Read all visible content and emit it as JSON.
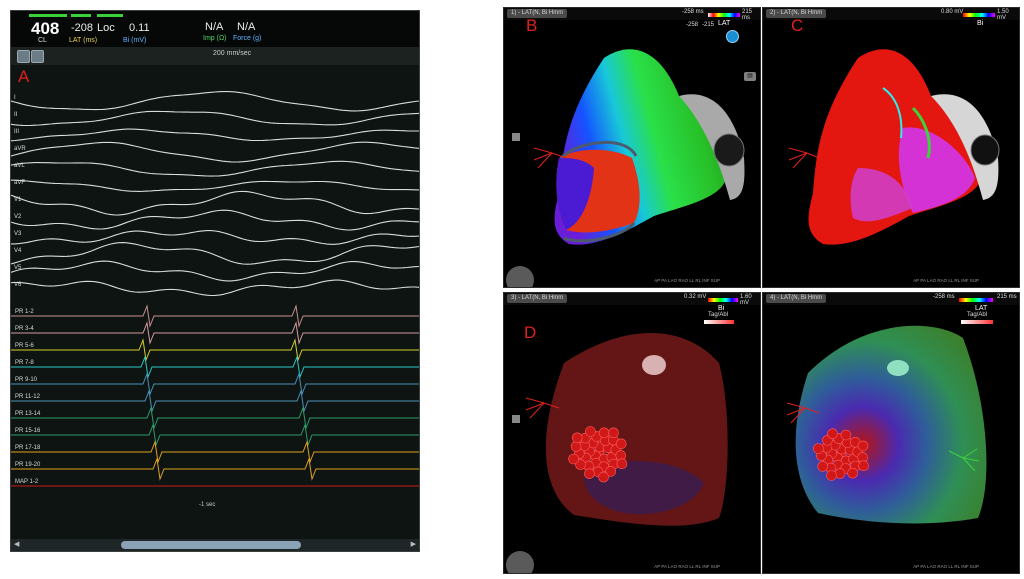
{
  "panel_a": {
    "letter": "A",
    "cl_value": "408",
    "cl_label": "CL",
    "lat_value": "-208",
    "lat_label": "LAT (ms)",
    "loc_label": "Loc",
    "bi_value": "0.11",
    "bi_label": "Bi (mV)",
    "imp_value": "N/A",
    "imp_label": "Imp (Ω)",
    "force_value": "N/A",
    "force_label": "Force (g)",
    "sweep_speed": "200 mm/sec",
    "time_scale": "-1 sec",
    "leads": [
      "I",
      "II",
      "III",
      "aVR",
      "aVL",
      "aVF",
      "V1",
      "V2",
      "V3",
      "V4",
      "V5",
      "V6"
    ],
    "pr_channels": [
      "PR 1-2",
      "PR 3-4",
      "PR 5-6",
      "PR 7-8",
      "PR 9-10",
      "PR 11-12",
      "PR 13-14",
      "PR 15-16",
      "PR 17-18",
      "PR 19-20",
      "MAP 1-2"
    ]
  },
  "panel_b": {
    "letter": "B",
    "tag": "1) - LAT(N, Bi Hmm",
    "map_label": "LAT",
    "range_low": "-258",
    "range_high": "-215",
    "scale_left": "-258 ms",
    "scale_right": "215 ms"
  },
  "panel_c": {
    "letter": "C",
    "tag": "2) - LAT(N, Bi Hmm",
    "map_label": "Bi",
    "scale_left": "0.80 mV",
    "scale_right": "1.50 mV"
  },
  "panel_d": {
    "letter": "D",
    "tag": "3) - LAT(N, Bi Hmm",
    "map_label": "Bi",
    "scale_left": "0.32 mV",
    "scale_right": "1.60 mV",
    "legend_item": "Tag/Abl"
  },
  "panel_e": {
    "tag": "4) - LAT(N, Bi Hmm",
    "map_label": "LAT",
    "scale_left": "-258 ms",
    "scale_right": "215 ms",
    "legend_item": "Tag/Abl"
  },
  "colors": {
    "accent_red": "#e0201c",
    "header_green": "#3ad13a"
  }
}
